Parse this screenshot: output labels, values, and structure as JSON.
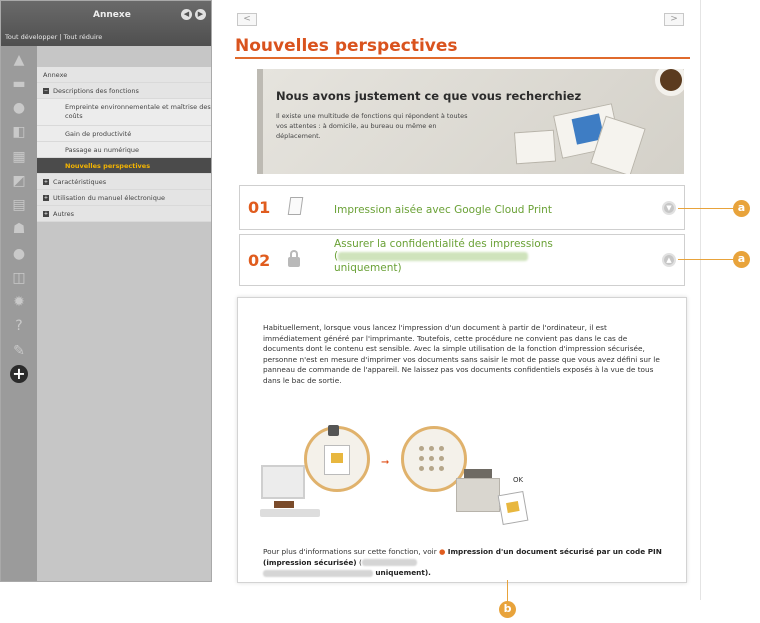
{
  "sidebar": {
    "title": "Annexe",
    "expand_all": "Tout développer",
    "separator": " | ",
    "collapse_all": "Tout réduire",
    "tree": [
      {
        "label": "Annexe",
        "level": 0,
        "active": false
      },
      {
        "label": "Descriptions des fonctions",
        "level": 1,
        "active": false
      },
      {
        "label": "Empreinte environnementale et maîtrise des coûts",
        "level": 2,
        "active": false
      },
      {
        "label": "Gain de productivité",
        "level": 2,
        "active": false
      },
      {
        "label": "Passage au numérique",
        "level": 2,
        "active": false
      },
      {
        "label": "Nouvelles perspectives",
        "level": 2,
        "active": true
      },
      {
        "label": "Caractéristiques",
        "level": 1,
        "active": false
      },
      {
        "label": "Utilisation du manuel électronique",
        "level": 1,
        "active": false
      },
      {
        "label": "Autres",
        "level": 1,
        "active": false
      }
    ],
    "icons": [
      "warning-icon",
      "printer-icon",
      "hand-icon",
      "copy-icon",
      "fax-icon",
      "scan-icon",
      "tray-icon",
      "network-icon",
      "security-icon",
      "device-icon",
      "gear-icon",
      "help-icon",
      "wrench-icon",
      "plus-icon"
    ]
  },
  "nav": {
    "prev": "<",
    "next": ">"
  },
  "page": {
    "title": "Nouvelles perspectives"
  },
  "banner": {
    "heading": "Nous avons justement ce que vous recherchiez",
    "text": "Il existe une multitude de fonctions qui répondent à toutes vos attentes : à domicile, au bureau ou même en déplacement."
  },
  "features": [
    {
      "number": "01",
      "title": "Impression aisée avec Google Cloud Print"
    },
    {
      "number": "02",
      "title_line1": "Assurer la confidentialité des impressions",
      "title_open": "(",
      "title_close": "uniquement)"
    }
  ],
  "callouts": {
    "a": "a",
    "b": "b"
  },
  "panel": {
    "paragraph": "Habituellement, lorsque vous lancez l'impression d'un document à partir de l'ordinateur, il est immédiatement généré par l'imprimante. Toutefois, cette procédure ne convient pas dans le cas de documents dont le contenu est sensible. Avec la simple utilisation de la fonction d'impression sécurisée, personne n'est en mesure d'imprimer vos documents sans saisir le mot de passe que vous avez défini sur le panneau de commande de l'appareil. Ne laissez pas vos documents confidentiels exposés à la vue de tous dans le bac de sortie.",
    "ok_label": "OK",
    "more_prefix": "Pour plus d'informations sur cette fonction, voir",
    "more_link": "Impression d'un document sécurisé par un code PIN (impression sécurisée)",
    "more_open": "(",
    "more_suffix": "uniquement)."
  },
  "colors": {
    "accent": "#e05c1e",
    "link_green": "#6aa136",
    "callout": "#e8a33b"
  }
}
